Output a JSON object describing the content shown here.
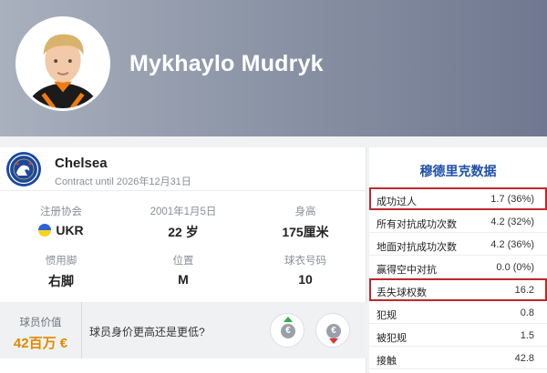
{
  "player": {
    "name": "Mykhaylo Mudryk"
  },
  "club": {
    "name": "Chelsea",
    "contract": "Contract until 2026年12月31日"
  },
  "info": [
    {
      "label": "注册协会",
      "value": "UKR",
      "flag": true
    },
    {
      "label": "2001年1月5日",
      "value": "22 岁"
    },
    {
      "label": "身高",
      "value": "175厘米"
    },
    {
      "label": "惯用脚",
      "value": "右脚"
    },
    {
      "label": "位置",
      "value": "M"
    },
    {
      "label": "球衣号码",
      "value": "10"
    }
  ],
  "market": {
    "label": "球员价值",
    "value": "42百万 €",
    "question": "球员身价更高还是更低?",
    "coin_symbol": "€"
  },
  "stats": {
    "title": "穆德里克数据",
    "rows": [
      {
        "label": "成功过人",
        "value": "1.7 (36%)",
        "highlight": true
      },
      {
        "label": "所有对抗成功次数",
        "value": "4.2 (32%)",
        "highlight": false
      },
      {
        "label": "地面对抗成功次数",
        "value": "4.2 (36%)",
        "highlight": false
      },
      {
        "label": "赢得空中对抗",
        "value": "0.0 (0%)",
        "highlight": false
      },
      {
        "label": "丢失球权数",
        "value": "16.2",
        "highlight": true
      },
      {
        "label": "犯规",
        "value": "0.8",
        "highlight": false
      },
      {
        "label": "被犯规",
        "value": "1.5",
        "highlight": false
      },
      {
        "label": "接触",
        "value": "42.8",
        "highlight": false
      }
    ]
  },
  "colors": {
    "accent": "#1f4fa8",
    "market_value": "#e08a00",
    "highlight_border": "#c0282d",
    "up": "#2eae4a",
    "down": "#e0362c"
  }
}
